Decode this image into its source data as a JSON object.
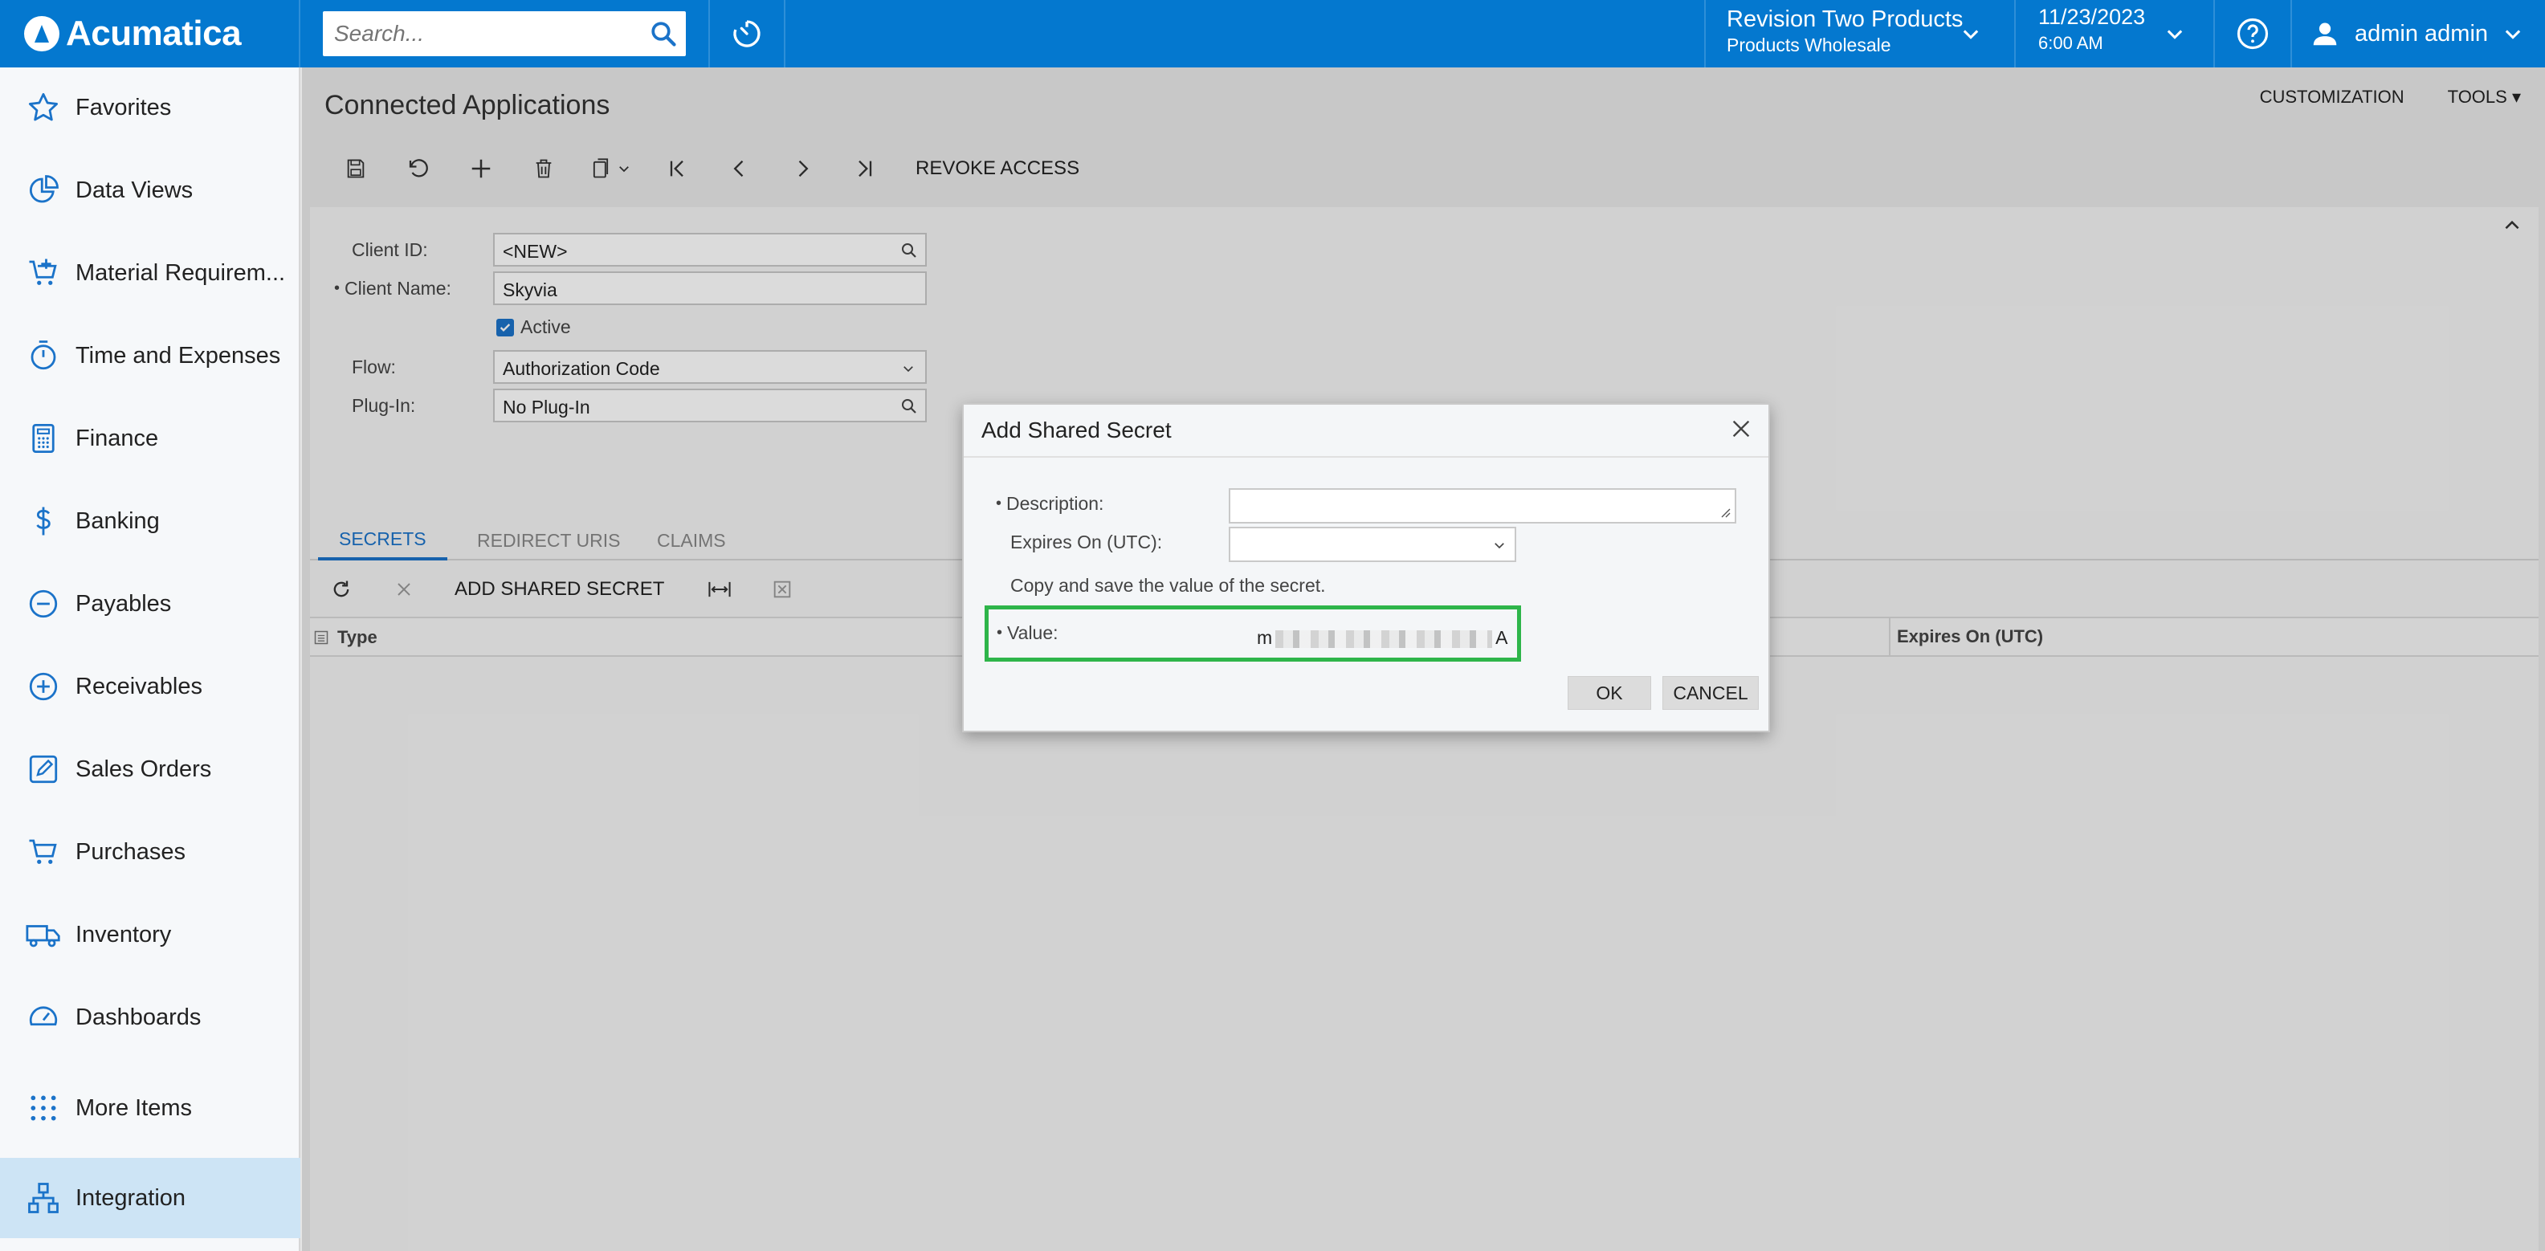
{
  "app": {
    "name": "Acumatica"
  },
  "search": {
    "placeholder": "Search..."
  },
  "company": {
    "name": "Revision Two Products",
    "branch": "Products Wholesale"
  },
  "datetime": {
    "date": "11/23/2023",
    "time": "6:00 AM"
  },
  "user": {
    "name": "admin admin"
  },
  "sidebar": {
    "items": [
      {
        "label": "Favorites",
        "icon": "star-icon"
      },
      {
        "label": "Data Views",
        "icon": "pie-chart-icon"
      },
      {
        "label": "Material Requirem...",
        "icon": "cart-plus-icon"
      },
      {
        "label": "Time and Expenses",
        "icon": "stopwatch-icon"
      },
      {
        "label": "Finance",
        "icon": "calculator-icon"
      },
      {
        "label": "Banking",
        "icon": "dollar-icon"
      },
      {
        "label": "Payables",
        "icon": "minus-circle-icon"
      },
      {
        "label": "Receivables",
        "icon": "plus-circle-icon"
      },
      {
        "label": "Sales Orders",
        "icon": "edit-icon"
      },
      {
        "label": "Purchases",
        "icon": "cart-icon"
      },
      {
        "label": "Inventory",
        "icon": "truck-icon"
      },
      {
        "label": "Dashboards",
        "icon": "gauge-icon"
      },
      {
        "label": "More Items",
        "icon": "grid-dots-icon"
      },
      {
        "label": "Integration",
        "icon": "hierarchy-icon"
      }
    ]
  },
  "page": {
    "title": "Connected Applications",
    "customization": "CUSTOMIZATION",
    "tools": "TOOLS",
    "revoke": "REVOKE ACCESS"
  },
  "form": {
    "client_id_label": "Client ID:",
    "client_id": "<NEW>",
    "client_name_label": "Client Name:",
    "client_name": "Skyvia",
    "active_label": "Active",
    "flow_label": "Flow:",
    "flow": "Authorization Code",
    "plugin_label": "Plug-In:",
    "plugin": "No Plug-In"
  },
  "tabs": [
    "SECRETS",
    "REDIRECT URIS",
    "CLAIMS"
  ],
  "grid": {
    "add_secret": "ADD SHARED SECRET",
    "col_type": "Type",
    "col_expires": "Expires On (UTC)"
  },
  "dialog": {
    "title": "Add Shared Secret",
    "description_label": "Description:",
    "expires_label": "Expires On (UTC):",
    "note": "Copy and save the value of the secret.",
    "value_label": "Value:",
    "value_start": "m",
    "value_end": "A",
    "ok": "OK",
    "cancel": "CANCEL"
  },
  "colors": {
    "brand": "#0478cf",
    "highlight": "#2eb54a",
    "accent": "#1b73c9"
  }
}
